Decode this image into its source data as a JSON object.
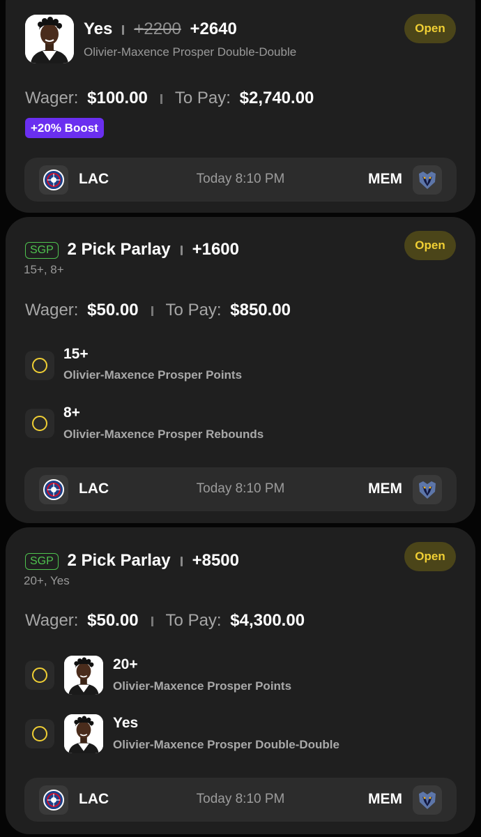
{
  "colors": {
    "background": "#050505",
    "card": "#1f1f1f",
    "open_badge_bg": "#4b4519",
    "open_badge_text": "#f0cf34",
    "boost": "#6a2ff0",
    "sgp_green": "#4fc34f",
    "pending_circle": "#f0cf34"
  },
  "bets": [
    {
      "status": "Open",
      "selection": "Yes",
      "original_odds": "+2200",
      "boosted_odds": "+2640",
      "market": "Olivier-Maxence Prosper Double-Double",
      "wager_label": "Wager:",
      "wager": "$100.00",
      "to_pay_label": "To Pay:",
      "to_pay": "$2,740.00",
      "boost": "+20% Boost",
      "game": {
        "home_abbr": "LAC",
        "away_abbr": "MEM",
        "time": "Today 8:10 PM",
        "home_icon": "clippers-logo-icon",
        "away_icon": "grizzlies-logo-icon"
      }
    },
    {
      "status": "Open",
      "sgp_badge": "SGP",
      "title": "2 Pick Parlay",
      "odds": "+1600",
      "summary": "15+, 8+",
      "wager_label": "Wager:",
      "wager": "$50.00",
      "to_pay_label": "To Pay:",
      "to_pay": "$850.00",
      "legs": [
        {
          "line": "15+",
          "desc": "Olivier-Maxence Prosper Points"
        },
        {
          "line": "8+",
          "desc": "Olivier-Maxence Prosper Rebounds"
        }
      ],
      "game": {
        "home_abbr": "LAC",
        "away_abbr": "MEM",
        "time": "Today 8:10 PM"
      }
    },
    {
      "status": "Open",
      "sgp_badge": "SGP",
      "title": "2 Pick Parlay",
      "odds": "+8500",
      "summary": "20+, Yes",
      "wager_label": "Wager:",
      "wager": "$50.00",
      "to_pay_label": "To Pay:",
      "to_pay": "$4,300.00",
      "legs": [
        {
          "line": "20+",
          "desc": "Olivier-Maxence Prosper Points"
        },
        {
          "line": "Yes",
          "desc": "Olivier-Maxence Prosper Double-Double"
        }
      ],
      "game": {
        "home_abbr": "LAC",
        "away_abbr": "MEM",
        "time": "Today 8:10 PM"
      }
    }
  ]
}
